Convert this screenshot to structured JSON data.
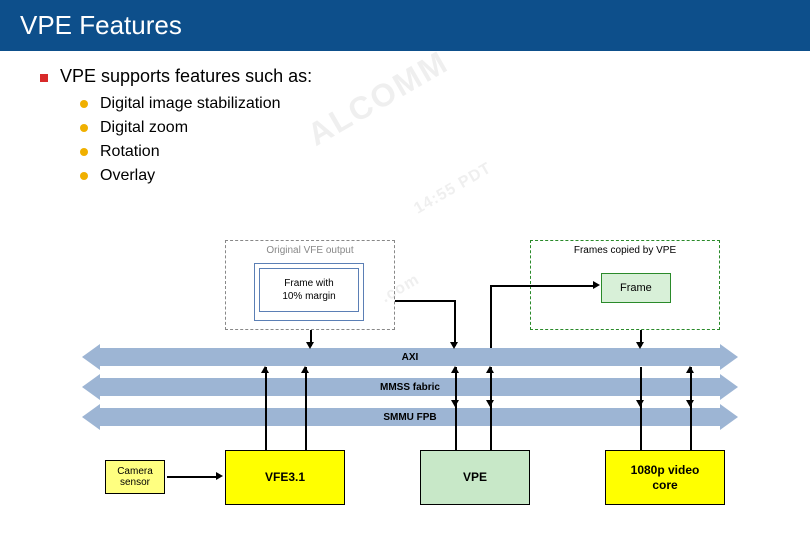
{
  "title": "VPE Features",
  "main_bullet": "VPE supports features such as:",
  "sub_bullets": [
    "Digital image stabilization",
    "Digital zoom",
    "Rotation",
    "Overlay"
  ],
  "diagram": {
    "original_vfe_label": "Original VFE output",
    "frame_margin_label": "Frame with\n10% margin",
    "frames_copied_label": "Frames copied by VPE",
    "frame_label": "Frame",
    "bus1": "AXI",
    "bus2": "MMSS fabric",
    "bus3": "SMMU FPB",
    "camera_sensor": "Camera\nsensor",
    "vfe": "VFE3.1",
    "vpe": "VPE",
    "video_core": "1080p video\ncore"
  },
  "watermarks": {
    "main": "ALCOMM",
    "time": "14:55 PDT",
    "site": ".com"
  }
}
